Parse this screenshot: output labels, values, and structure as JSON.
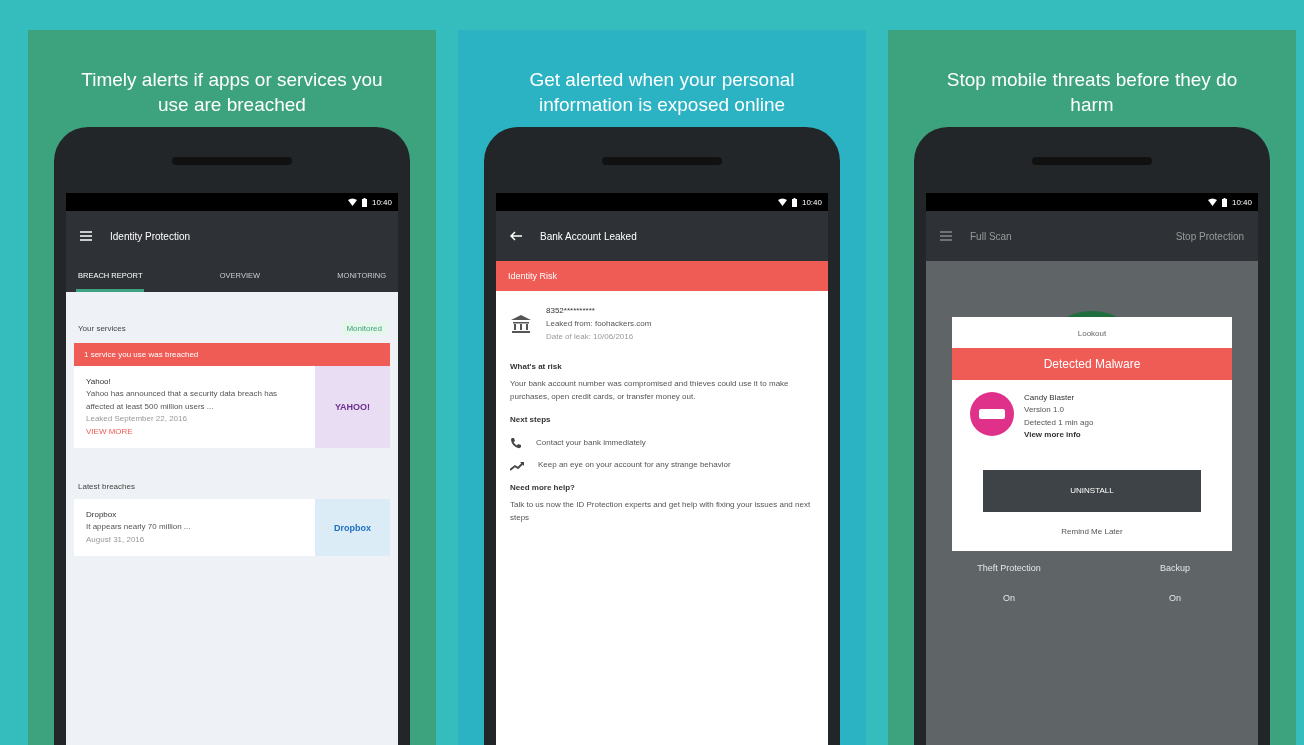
{
  "panels": [
    {
      "kind": "breach",
      "color": "#3da37e",
      "heading": "Timely alerts if apps or services you use are breached",
      "time": "10:40",
      "title": "Identity Protection",
      "tabs": [
        {
          "label": "BREACH REPORT",
          "selected": true
        },
        {
          "label": "OVERVIEW",
          "selected": false
        },
        {
          "label": "MONITORING",
          "selected": false
        }
      ],
      "sections": [
        {
          "title": "Your services",
          "status": "Monitored",
          "alert": "1 service you use was breached",
          "cards": [
            {
              "name": "Yahoo!",
              "text": "Yahoo has announced that a security data breach has affected at least 500 million users ...",
              "date": "Leaked September 22, 2016",
              "link": "VIEW MORE",
              "logo": "YAHOO!"
            }
          ]
        },
        {
          "title": "Latest breaches",
          "cards": [
            {
              "name": "Dropbox",
              "text": "It appears nearly 70 million ...",
              "date": "August 31, 2016",
              "logo": "Dropbox"
            }
          ]
        }
      ]
    },
    {
      "kind": "detail",
      "color": "#2bb3c4",
      "heading": "Get alerted when your personal information is exposed online",
      "time": "10:40",
      "title": "Bank Account Leaked",
      "risk": "Identity Risk",
      "leak": {
        "value": "8352**********",
        "source": "Leaked from: foohackers.com",
        "date": "Date of leak: 10/06/2016"
      },
      "risk_heading": "What's at risk",
      "risk_text": "Your bank account number was compromised and thieves could use it to make purchases, open credit cards, or transfer money out.",
      "steps_heading": "Next steps",
      "steps": [
        {
          "kind": "phone",
          "text": "Contact your bank immediately"
        },
        {
          "kind": "trend",
          "text": "Keep an eye on your account for any strange behavior"
        }
      ],
      "help_heading": "Need more help?",
      "help_text": "Talk to us now the ID Protection experts and get help with fixing your issues and next steps"
    },
    {
      "kind": "malware",
      "color": "#3da37e",
      "heading": "Stop mobile threats before they do harm",
      "time": "10:40",
      "title": "Full Scan",
      "action": "Stop Protection",
      "dialog": {
        "brand": "Lookout",
        "banner": "Detected Malware",
        "app": "Candy Blaster",
        "lines": [
          "Version 1.0",
          "Detected 1 min ago"
        ],
        "link": "View more info",
        "button": "UNINSTALL",
        "secondary": "Remind Me Later"
      },
      "features": [
        {
          "label": "Theft Protection",
          "value": "On"
        },
        {
          "label": "Backup",
          "value": "On"
        }
      ]
    }
  ]
}
